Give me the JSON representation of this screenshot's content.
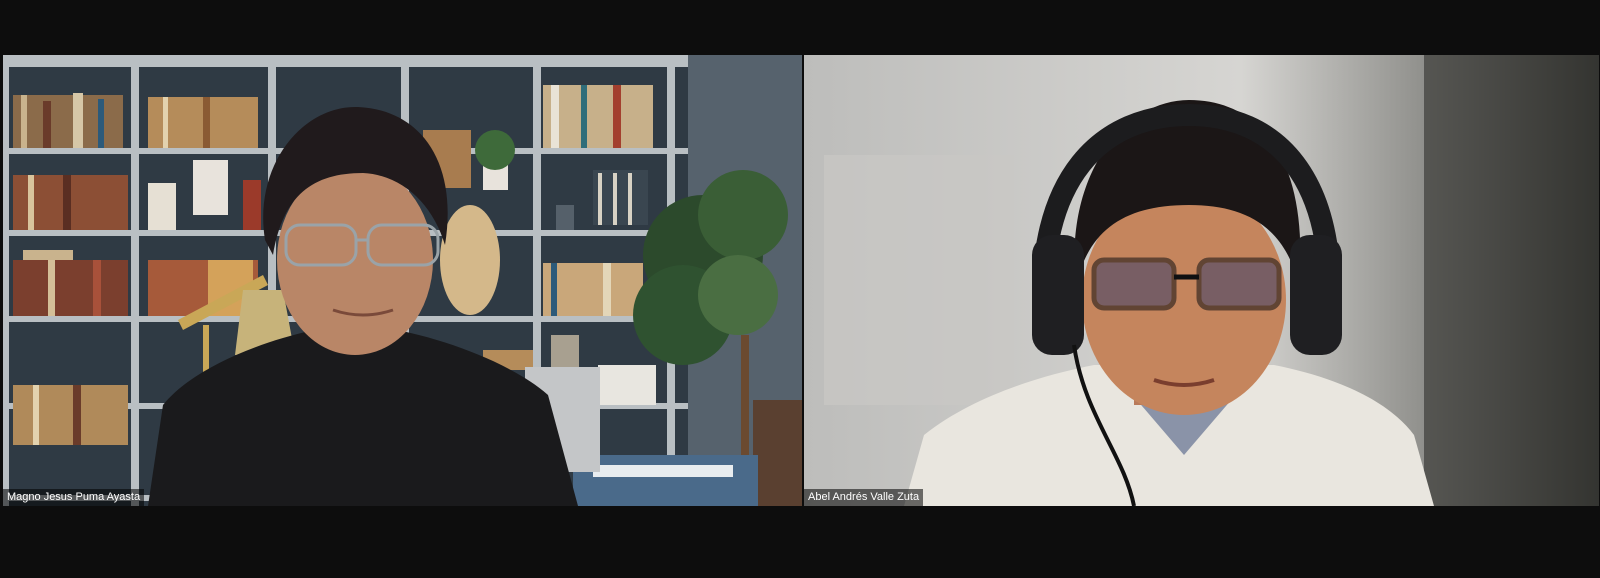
{
  "meeting": {
    "participants": [
      {
        "name": "Magno Jesus Puma Ayasta"
      },
      {
        "name": "Abel Andrés Valle Zuta"
      }
    ]
  }
}
